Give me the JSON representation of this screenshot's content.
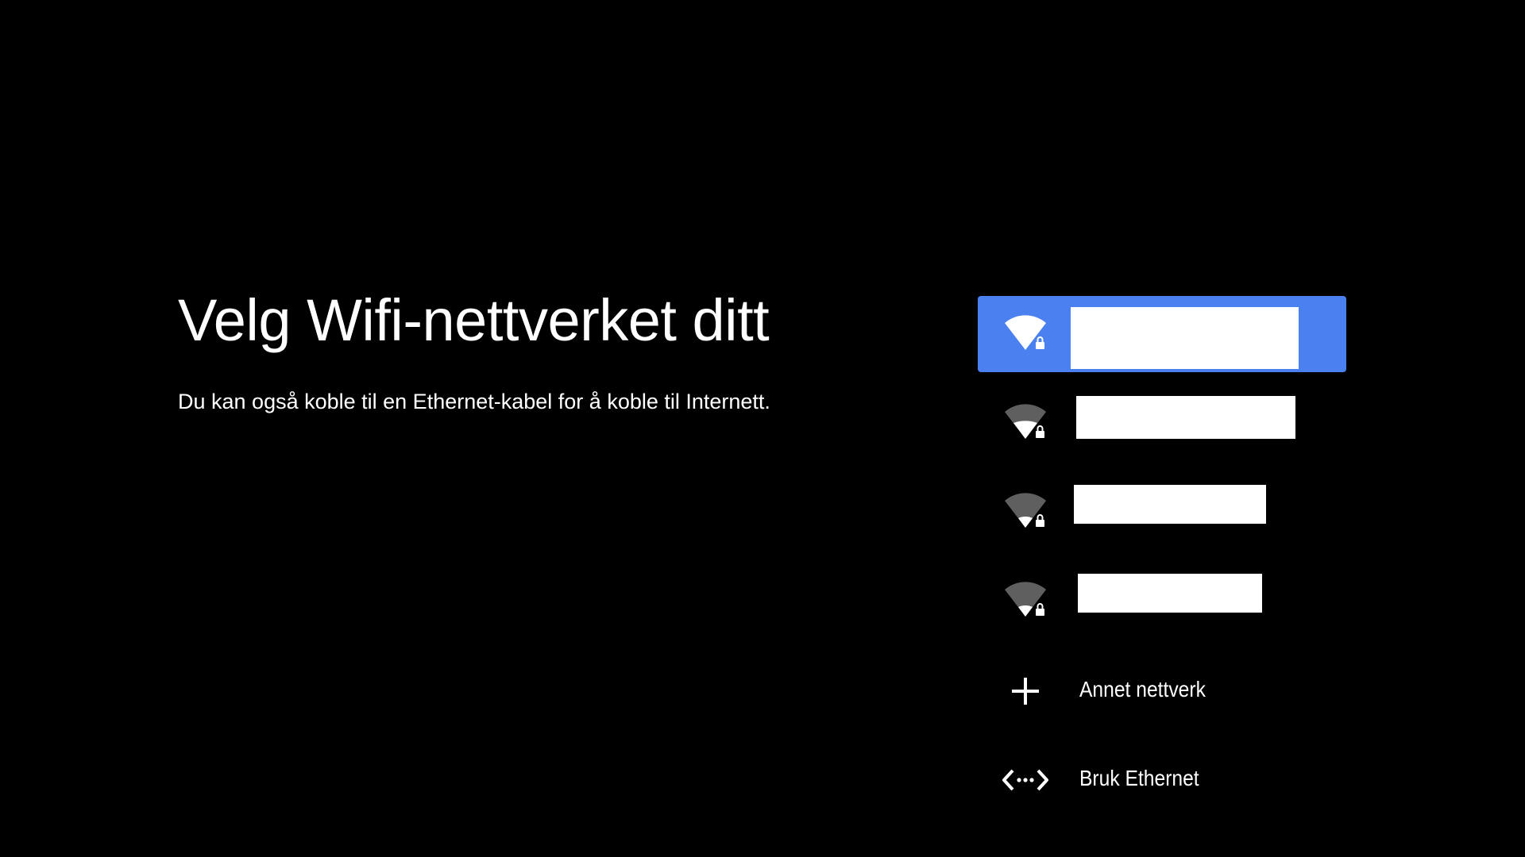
{
  "header": {
    "title": "Velg Wifi-nettverket ditt",
    "subtitle": "Du kan også koble til en Ethernet-kabel for å koble til Internett."
  },
  "colors": {
    "background": "#000000",
    "selected": "#4a80f0",
    "text": "#ffffff",
    "signal_dim": "#5f5f5f"
  },
  "networks": [
    {
      "name": "",
      "secured": true,
      "signal": 1.0,
      "selected": true,
      "icon": "wifi-lock-icon"
    },
    {
      "name": "",
      "secured": true,
      "signal": 0.5,
      "selected": false,
      "icon": "wifi-lock-icon"
    },
    {
      "name": "",
      "secured": true,
      "signal": 0.33,
      "selected": false,
      "icon": "wifi-lock-icon"
    },
    {
      "name": "",
      "secured": true,
      "signal": 0.33,
      "selected": false,
      "icon": "wifi-lock-icon"
    }
  ],
  "actions": {
    "other_network": {
      "label": "Annet nettverk",
      "icon": "plus-icon"
    },
    "use_ethernet": {
      "label": "Bruk Ethernet",
      "icon": "ethernet-icon"
    }
  }
}
